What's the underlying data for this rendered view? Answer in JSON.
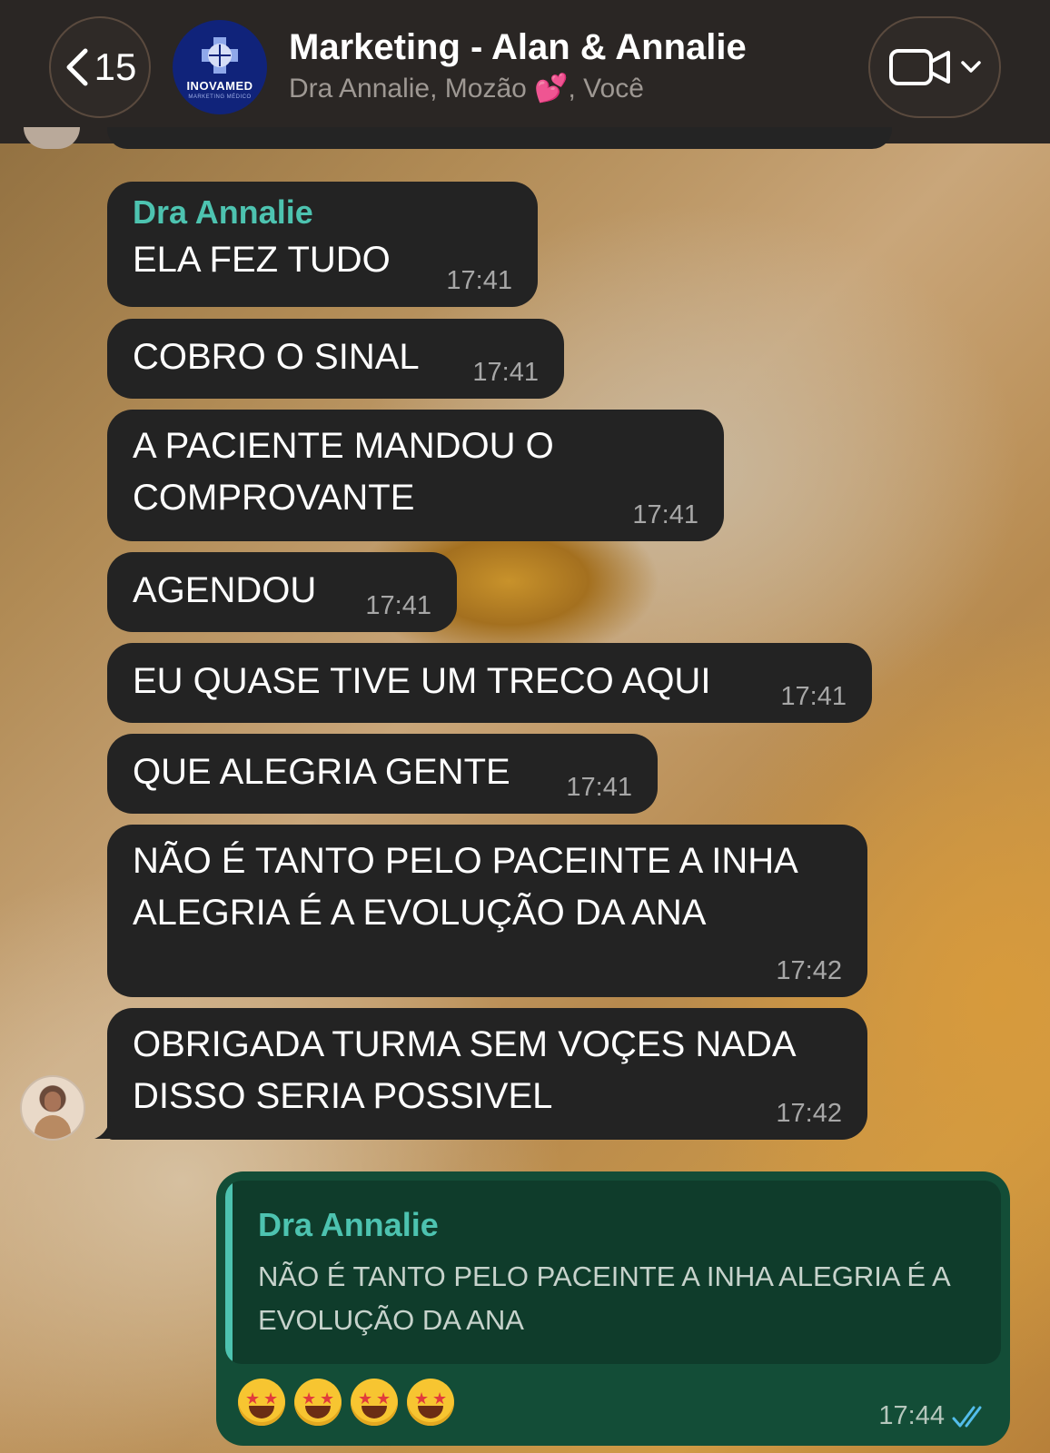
{
  "header": {
    "back_count": "15",
    "group_avatar": {
      "logo_text": "INOVAMED",
      "logo_subtext": "MARKETING MÉDICO"
    },
    "title": "Marketing - Alan & Annalie",
    "subtitle": "Dra Annalie, Mozão 💕, Você",
    "video_icon": "video-camera-icon"
  },
  "messages": [
    {
      "sender": "Dra Annalie",
      "text": "ELA FEZ TUDO",
      "time": "17:41"
    },
    {
      "text": "COBRO O SINAL",
      "time": "17:41"
    },
    {
      "text": "A PACIENTE MANDOU O\nCOMPROVANTE",
      "time": "17:41"
    },
    {
      "text": "AGENDOU",
      "time": "17:41"
    },
    {
      "text": "EU QUASE TIVE UM TRECO AQUI",
      "time": "17:41"
    },
    {
      "text": "QUE ALEGRIA GENTE",
      "time": "17:41"
    },
    {
      "text": "NÃO É TANTO PELO PACEINTE A INHA\nALEGRIA É A EVOLUÇÃO DA ANA",
      "time": "17:42"
    },
    {
      "text": "OBRIGADA TURMA SEM VOÇES NADA\nDISSO SERIA POSSIVEL",
      "time": "17:42"
    }
  ],
  "reply": {
    "quoted_sender": "Dra Annalie",
    "quoted_text": "NÃO É TANTO PELO PACEINTE A INHA ALEGRIA É A EVOLUÇÃO DA ANA",
    "emojis": "🤩🤩🤩🤩",
    "time": "17:44",
    "status_icon": "double-check-read-icon"
  },
  "colors": {
    "header_bg": "#2a2624",
    "incoming_bubble": "#232323",
    "outgoing_bubble": "#134d37",
    "sender_name": "#4dc3b0",
    "read_check": "#53bdeb"
  }
}
